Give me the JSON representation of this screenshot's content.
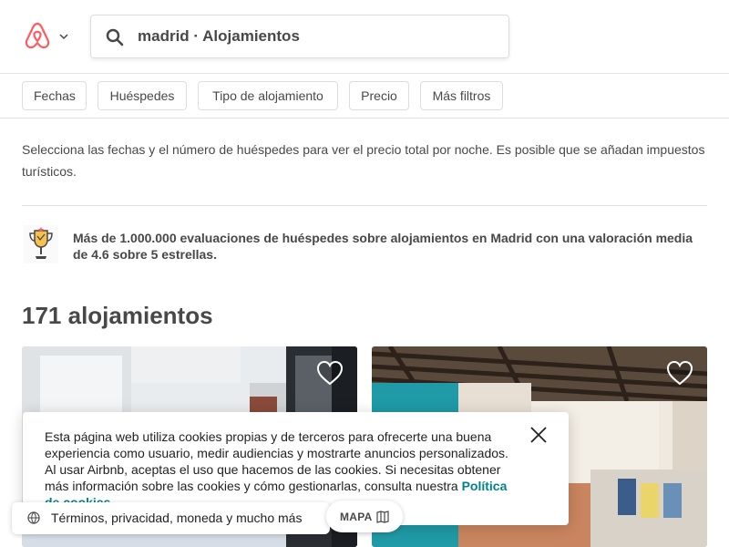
{
  "header": {
    "search_text": "madrid · Alojamientos"
  },
  "filters": [
    {
      "label": "Fechas"
    },
    {
      "label": "Huéspedes"
    },
    {
      "label": "Tipo de alojamiento"
    },
    {
      "label": "Precio"
    },
    {
      "label": "Más filtros"
    }
  ],
  "info": {
    "price_note": "Selecciona las fechas y el número de huéspedes para ver el precio total por noche. Es posible que se añadan impuestos turísticos."
  },
  "reviews": {
    "text": "Más de 1.000.000 evaluaciones de huéspedes sobre alojamientos en Madrid con una valoración media de 4.6 sobre 5 estrellas."
  },
  "listings": {
    "count_title": "171 alojamientos"
  },
  "cookie_banner": {
    "text": "Esta página web utiliza cookies propias y de terceros para ofrecerte una buena experiencia como usuario, medir audiencias y mostrarte anuncios personalizados. Al usar Airbnb, aceptas el uso que hacemos de las cookies. Si necesitas obtener más información sobre las cookies y cómo gestionarlas, consulta nuestra ",
    "link_text": "Política de cookies."
  },
  "footer": {
    "text": "Términos, privacidad, moneda y mucho más"
  },
  "map_button": {
    "label": "MAPA"
  },
  "colors": {
    "brand": "#FF5A5F",
    "link": "#008489",
    "text": "#484848",
    "border": "#DDDDDD"
  },
  "icons": [
    "airbnb-logo-icon",
    "chevron-down-icon",
    "search-icon",
    "trophy-icon",
    "heart-icon",
    "close-icon",
    "globe-icon",
    "map-icon"
  ]
}
